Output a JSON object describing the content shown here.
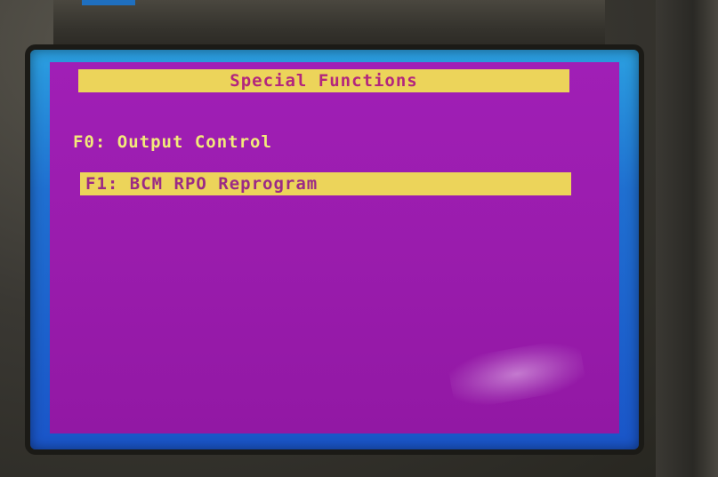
{
  "screen": {
    "title": "Special Functions",
    "menu_items": [
      {
        "label": "F0: Output Control",
        "selected": false
      },
      {
        "label": "F1: BCM RPO Reprogram",
        "selected": true
      }
    ]
  },
  "colors": {
    "screen_bg": "#9a1cad",
    "highlight_bg": "#ecd45a",
    "bezel": "#1f6fd0",
    "item_text": "#f2ea7a",
    "selected_text": "#9b2a86"
  }
}
